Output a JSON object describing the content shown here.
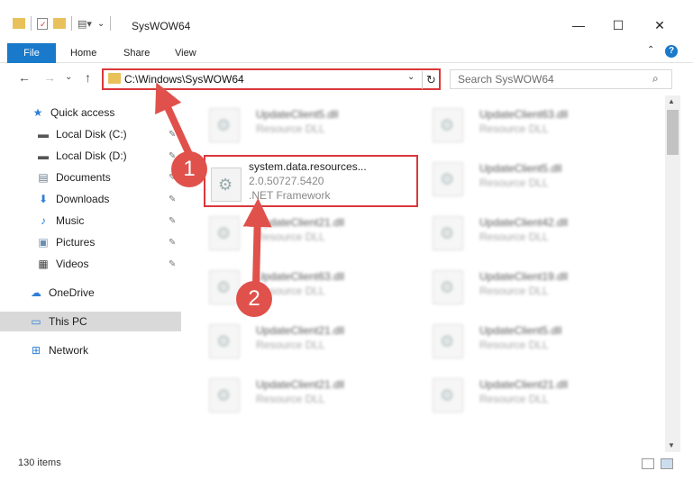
{
  "window": {
    "title": "SysWOW64",
    "minimize": "—",
    "maximize": "☐",
    "close": "✕"
  },
  "ribbon": {
    "tabs": [
      "File",
      "Home",
      "Share",
      "View"
    ],
    "help": "?"
  },
  "nav": {
    "back": "←",
    "forward": "→",
    "recent": "⌄",
    "up": "↑",
    "address": "C:\\Windows\\SysWOW64",
    "refresh": "↻",
    "search_placeholder": "Search SysWOW64"
  },
  "sidebar": {
    "items": [
      {
        "label": "Quick access",
        "icon": "star-icon",
        "glyph": "★",
        "color": "#2d7fd6",
        "pinned": false
      },
      {
        "label": "Local Disk (C:)",
        "icon": "drive-icon",
        "glyph": "▬",
        "color": "#555",
        "pinned": true
      },
      {
        "label": "Local Disk (D:)",
        "icon": "drive-icon",
        "glyph": "▬",
        "color": "#555",
        "pinned": true
      },
      {
        "label": "Documents",
        "icon": "documents-icon",
        "glyph": "▤",
        "color": "#6b7b8c",
        "pinned": true
      },
      {
        "label": "Downloads",
        "icon": "download-icon",
        "glyph": "⬇",
        "color": "#2d7fd6",
        "pinned": true
      },
      {
        "label": "Music",
        "icon": "music-icon",
        "glyph": "♪",
        "color": "#2d7fd6",
        "pinned": true
      },
      {
        "label": "Pictures",
        "icon": "pictures-icon",
        "glyph": "▣",
        "color": "#6b8fb0",
        "pinned": true
      },
      {
        "label": "Videos",
        "icon": "videos-icon",
        "glyph": "▦",
        "color": "#444",
        "pinned": true
      },
      {
        "label": "OneDrive",
        "icon": "cloud-icon",
        "glyph": "☁",
        "color": "#2d7fd6",
        "pinned": false
      },
      {
        "label": "This PC",
        "icon": "computer-icon",
        "glyph": "▭",
        "color": "#2d7fd6",
        "pinned": false
      },
      {
        "label": "Network",
        "icon": "network-icon",
        "glyph": "⊞",
        "color": "#2d7fd6",
        "pinned": false
      }
    ],
    "pin_glyph": "📌"
  },
  "files": {
    "highlighted": {
      "name": "system.data.resources...",
      "version": "2.0.50727.5420",
      "description": ".NET Framework"
    },
    "left_column": [
      {
        "name": "UpdateClient5.dll",
        "description": "Resource DLL"
      },
      {
        "name": "UpdateClient21.dll",
        "description": "Resource DLL"
      },
      {
        "name": "UpdateClient63.dll",
        "description": "Resource DLL"
      },
      {
        "name": "UpdateClient21.dll",
        "description": "Resource DLL"
      },
      {
        "name": "UpdateClient21.dll",
        "description": "Resource DLL"
      }
    ],
    "right_column": [
      {
        "name": "UpdateClient63.dll",
        "description": "Resource DLL"
      },
      {
        "name": "UpdateClient5.dll",
        "description": "Resource DLL"
      },
      {
        "name": "UpdateClient42.dll",
        "description": "Resource DLL"
      },
      {
        "name": "UpdateClient19.dll",
        "description": "Resource DLL"
      },
      {
        "name": "UpdateClient5.dll",
        "description": "Resource DLL"
      },
      {
        "name": "UpdateClient21.dll",
        "description": "Resource DLL"
      }
    ]
  },
  "status": {
    "item_count": "130 items"
  },
  "annotations": {
    "step1": "1",
    "step2": "2",
    "color": "#e0514b"
  }
}
